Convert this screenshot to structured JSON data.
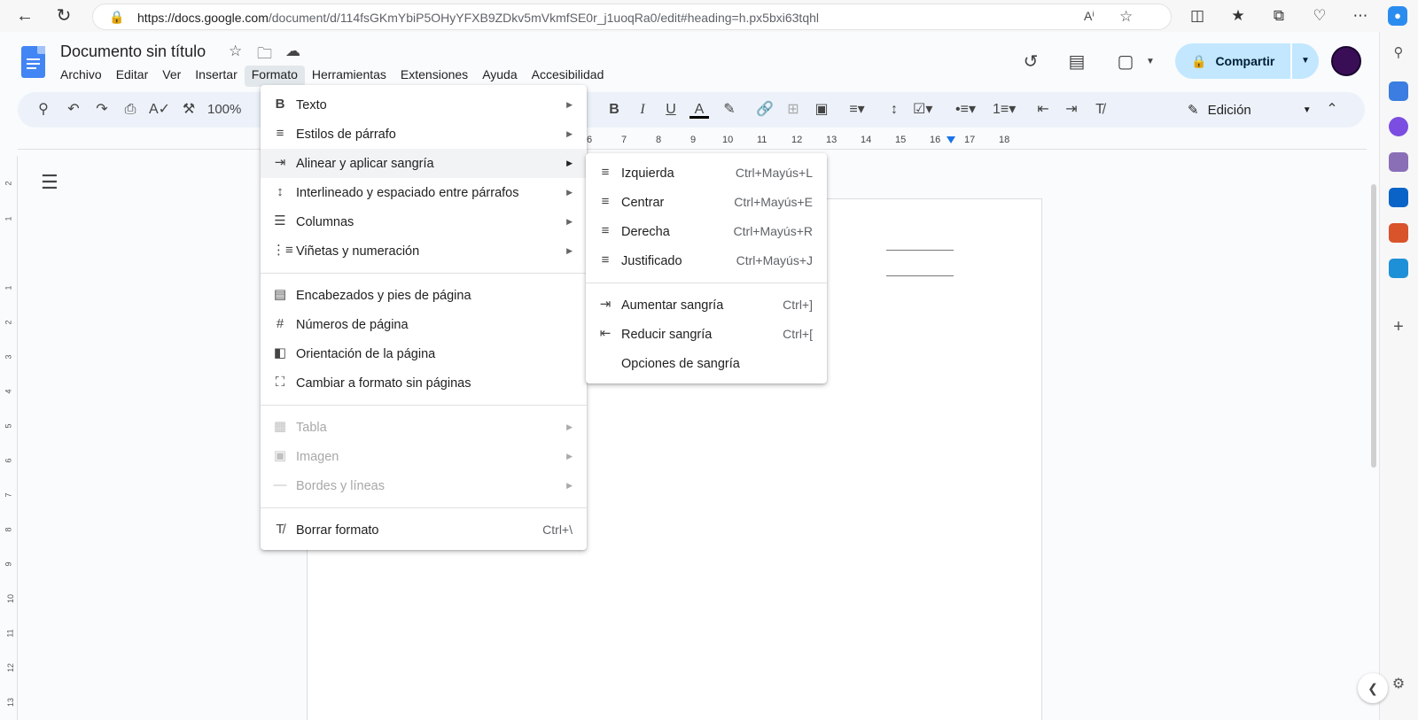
{
  "browser": {
    "url_host": "https://docs.google.com",
    "url_path": "/document/d/114fsGKmYbiP5OHyYFXB9ZDkv5mVkmfSE0r_j1uoqRa0/edit#heading=h.px5bxi63tqhl"
  },
  "doc": {
    "title": "Documento sin título",
    "menus": [
      "Archivo",
      "Editar",
      "Ver",
      "Insertar",
      "Formato",
      "Herramientas",
      "Extensiones",
      "Ayuda",
      "Accesibilidad"
    ]
  },
  "header": {
    "share_label": "Compartir"
  },
  "toolbar": {
    "zoom": "100%",
    "edit_mode": "Edición"
  },
  "ruler": {
    "labels": [
      "6",
      "7",
      "8",
      "9",
      "10",
      "11",
      "12",
      "13",
      "14",
      "15",
      "16",
      "17",
      "18"
    ],
    "left_labels": [
      "2",
      "1",
      "1",
      "2",
      "3",
      "4",
      "5",
      "6",
      "7",
      "8",
      "9",
      "10",
      "11",
      "12",
      "13"
    ]
  },
  "format_menu": {
    "items": [
      {
        "label": "Texto"
      },
      {
        "label": "Estilos de párrafo"
      },
      {
        "label": "Alinear y aplicar sangría"
      },
      {
        "label": "Interlineado y espaciado entre párrafos"
      },
      {
        "label": "Columnas"
      },
      {
        "label": "Viñetas y numeración"
      },
      {
        "label": "Encabezados y pies de página"
      },
      {
        "label": "Números de página"
      },
      {
        "label": "Orientación de la página"
      },
      {
        "label": "Cambiar a formato sin páginas"
      },
      {
        "label": "Tabla"
      },
      {
        "label": "Imagen"
      },
      {
        "label": "Bordes y líneas"
      },
      {
        "label": "Borrar formato",
        "shortcut": "Ctrl+\\"
      }
    ]
  },
  "align_submenu": {
    "items": [
      {
        "label": "Izquierda",
        "shortcut": "Ctrl+Mayús+L"
      },
      {
        "label": "Centrar",
        "shortcut": "Ctrl+Mayús+E"
      },
      {
        "label": "Derecha",
        "shortcut": "Ctrl+Mayús+R"
      },
      {
        "label": "Justificado",
        "shortcut": "Ctrl+Mayús+J"
      },
      {
        "label": "Aumentar sangría",
        "shortcut": "Ctrl+]"
      },
      {
        "label": "Reducir sangría",
        "shortcut": "Ctrl+["
      },
      {
        "label": "Opciones de sangría"
      }
    ]
  },
  "colors": {
    "share_bg": "#c2e7ff",
    "toolbar_bg": "#edf2fa",
    "doc_blue": "#4285f4",
    "accent": "#1a73e8"
  }
}
